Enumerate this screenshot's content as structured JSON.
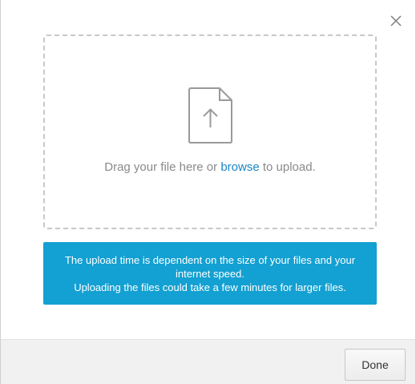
{
  "dialog": {
    "close_icon": "close-icon",
    "dropzone": {
      "icon": "file-upload-icon",
      "text_before": "Drag your file here or ",
      "browse_label": "browse",
      "text_after": " to upload."
    },
    "info": {
      "line1": "The upload time is dependent on the size of your files and your internet speed.",
      "line2": "Uploading the files could take a few minutes for larger files."
    },
    "footer": {
      "done_label": "Done"
    }
  },
  "colors": {
    "info_background": "#13a0d2",
    "link": "#1a86c4",
    "footer_background": "#f1f1f1"
  }
}
